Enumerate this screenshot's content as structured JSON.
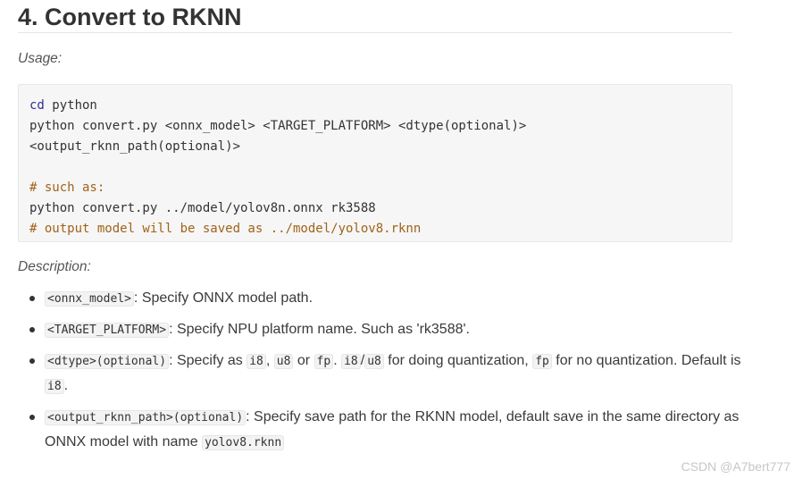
{
  "heading": "4. Convert to RKNN",
  "usage_label": "Usage:",
  "code": {
    "line1_kw": "cd",
    "line1_rest": " python",
    "line2": "python convert.py <onnx_model> <TARGET_PLATFORM> <dtype(optional)>",
    "line3": "<output_rknn_path(optional)>",
    "line5": "# such as:",
    "line6": "python convert.py ../model/yolov8n.onnx rk3588",
    "line7": "# output model will be saved as ../model/yolov8.rknn"
  },
  "description_label": "Description:",
  "items": [
    {
      "code1": "<onnx_model>",
      "text1": ": Specify ONNX model path."
    },
    {
      "code1": "<TARGET_PLATFORM>",
      "text1": ": Specify NPU platform name. Such as 'rk3588'."
    },
    {
      "code1": "<dtype>(optional)",
      "text1": ": Specify as ",
      "code2": "i8",
      "text2": ", ",
      "code3": "u8",
      "text3": " or ",
      "code4": "fp",
      "text4": ". ",
      "code5": "i8",
      "text5": "/",
      "code6": "u8",
      "text6": " for doing quantization, ",
      "code7": "fp",
      "text7": " for no quantization. Default is ",
      "code8": "i8",
      "text8": "."
    },
    {
      "code1": "<output_rknn_path>(optional)",
      "text1": ": Specify save path for the RKNN model, default save in the same directory as ONNX model with name ",
      "code2": "yolov8.rknn"
    }
  ],
  "watermark": "CSDN @A7bert777"
}
